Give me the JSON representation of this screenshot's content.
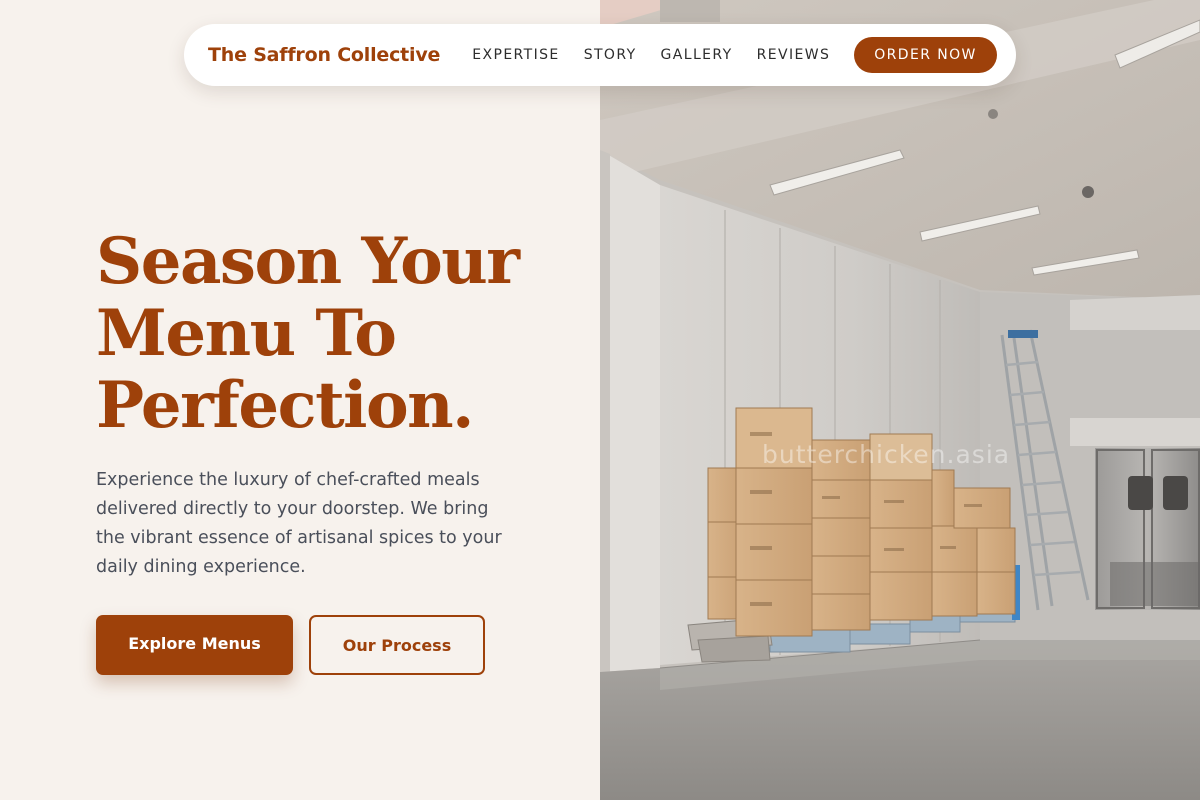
{
  "nav": {
    "brand": "The Saffron Collective",
    "links": [
      "EXPERTISE",
      "STORY",
      "GALLERY",
      "REVIEWS"
    ],
    "cta": "ORDER NOW"
  },
  "hero": {
    "title_lines": [
      "Season Your",
      "Menu To",
      "Perfection."
    ],
    "description": "Experience the luxury of chef-crafted meals delivered directly to your doorstep. We bring the vibrant essence of artisanal spices to your daily dining experience.",
    "primary_button": "Explore Menus",
    "secondary_button": "Our Process"
  },
  "image": {
    "alt": "warehouse loading dock with stacked cardboard boxes",
    "watermark": "butterchicken.asia"
  },
  "colors": {
    "accent": "#9e410a",
    "background": "#f7f2ed",
    "body_text": "#4a4f5a",
    "nav_text": "#2d2d2d"
  }
}
